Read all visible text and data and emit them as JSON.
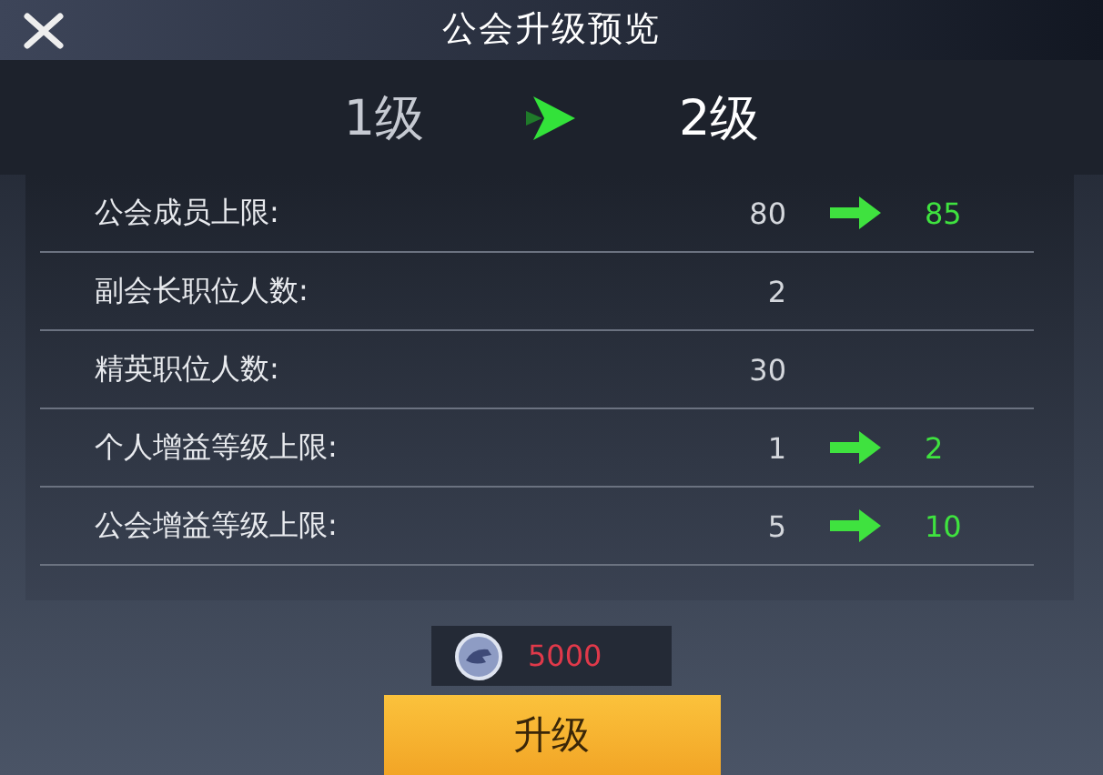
{
  "title": "公会升级预览",
  "levels": {
    "current": "1级",
    "next": "2级"
  },
  "stats": [
    {
      "label": "公会成员上限:",
      "value": "80",
      "next": "85"
    },
    {
      "label": "副会长职位人数:",
      "value": "2"
    },
    {
      "label": "精英职位人数:",
      "value": "30"
    },
    {
      "label": "个人增益等级上限:",
      "value": "1",
      "next": "2"
    },
    {
      "label": "公会增益等级上限:",
      "value": "5",
      "next": "10"
    }
  ],
  "cost": "5000",
  "button": "升级"
}
